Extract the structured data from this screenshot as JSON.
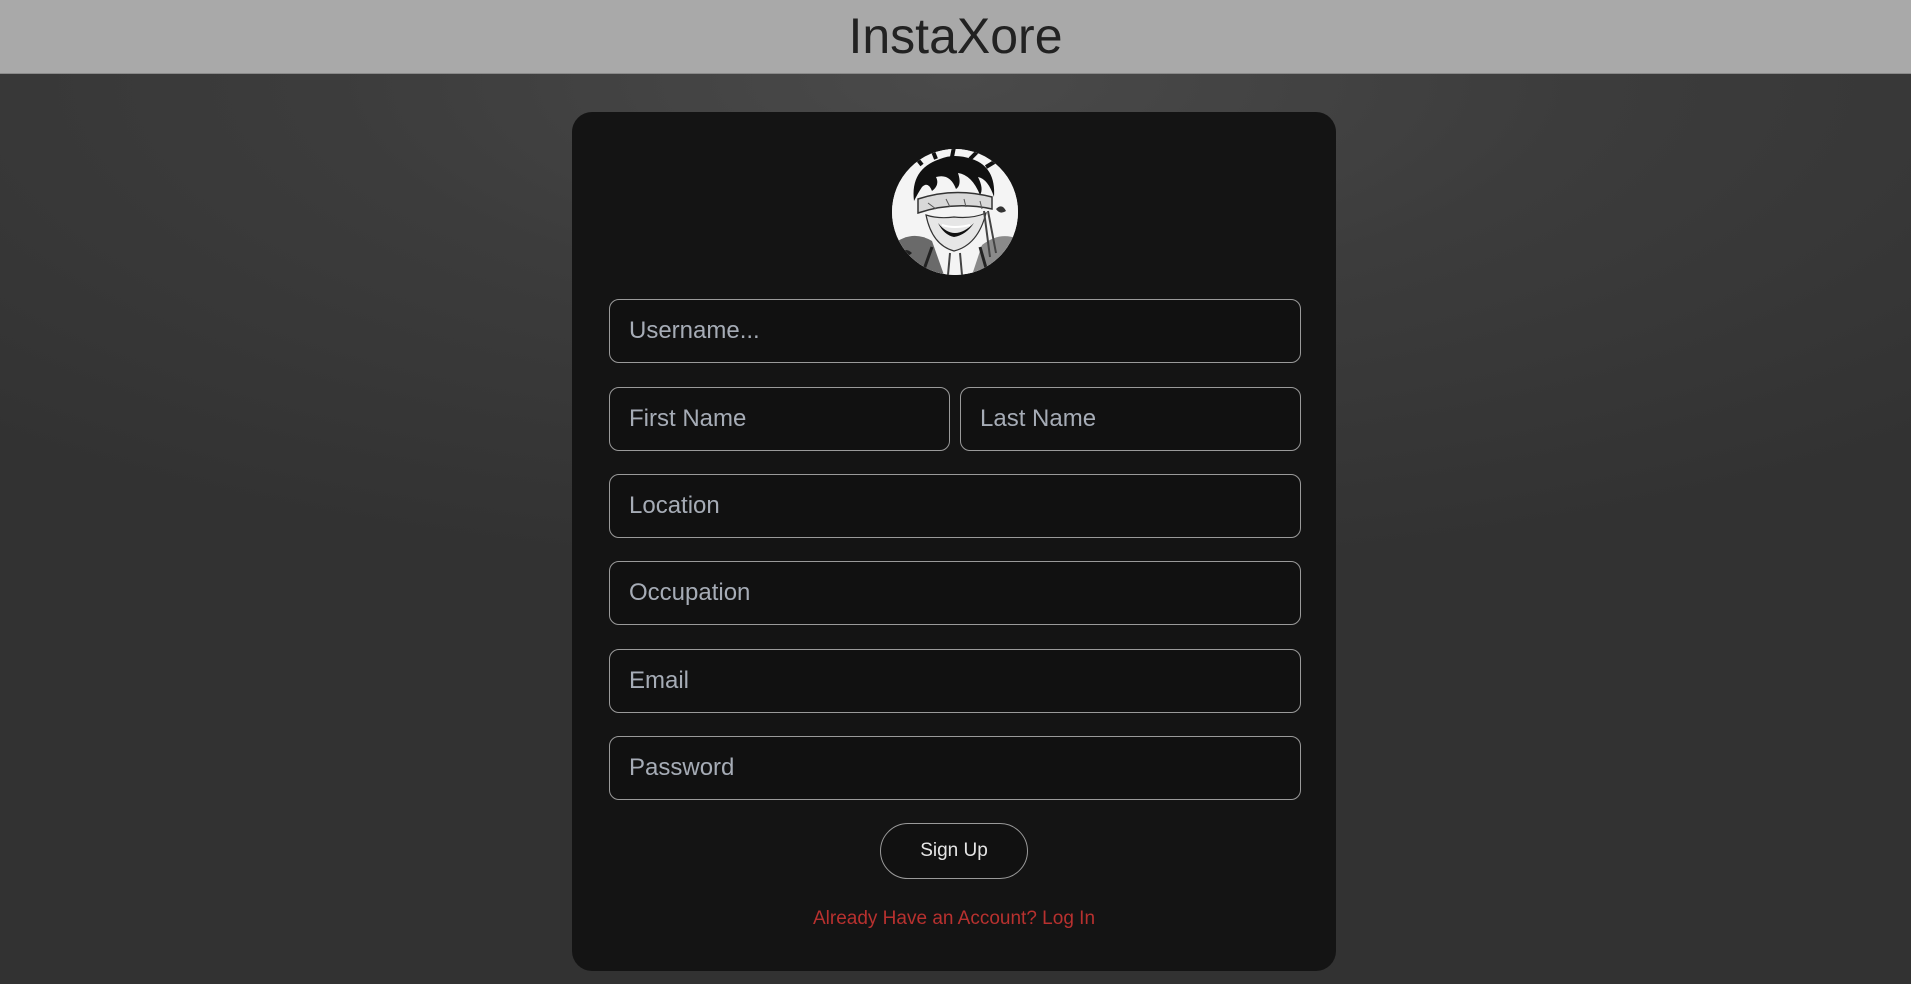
{
  "header": {
    "title": "InstaXore"
  },
  "form": {
    "avatar_icon": "user-avatar-illustration",
    "username_placeholder": "Username...",
    "first_name_placeholder": "First Name",
    "last_name_placeholder": "Last Name",
    "location_placeholder": "Location",
    "occupation_placeholder": "Occupation",
    "email_placeholder": "Email",
    "password_placeholder": "Password",
    "signup_label": "Sign Up",
    "login_link_label": "Already Have an Account? Log In"
  },
  "colors": {
    "header_bg": "#a9a9a9",
    "card_bg": "#141414",
    "link": "#b8312f"
  }
}
